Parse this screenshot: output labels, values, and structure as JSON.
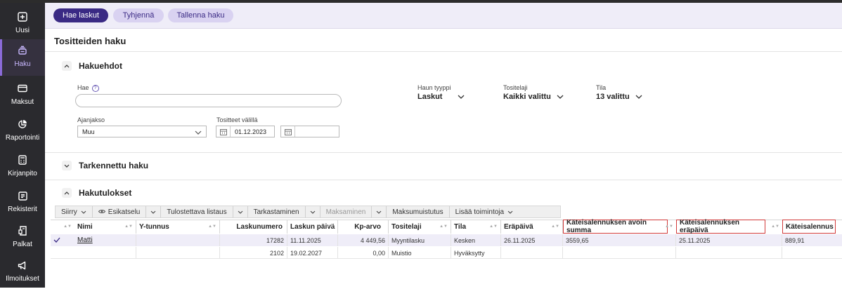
{
  "sidebar": {
    "items": [
      {
        "label": "Uusi",
        "icon": "plus-square-icon"
      },
      {
        "label": "Haku",
        "icon": "search-stack-icon",
        "active": true
      },
      {
        "label": "Maksut",
        "icon": "card-icon"
      },
      {
        "label": "Raportointi",
        "icon": "pie-chart-icon"
      },
      {
        "label": "Kirjanpito",
        "icon": "calculator-icon"
      },
      {
        "label": "Rekisterit",
        "icon": "register-icon"
      },
      {
        "label": "Palkat",
        "icon": "payslip-icon"
      },
      {
        "label": "Ilmoitukset",
        "icon": "megaphone-icon"
      }
    ]
  },
  "toolbar": {
    "search_label": "Hae laskut",
    "clear_label": "Tyhjennä",
    "save_label": "Tallenna haku"
  },
  "page": {
    "title": "Tositteiden haku"
  },
  "criteria": {
    "title": "Hakuehdot",
    "search_label": "Hae",
    "search_value": "",
    "period_label": "Ajanjakso",
    "period_value": "Muu",
    "docs_between_label": "Tositteet välillä",
    "date_from": "01.12.2023",
    "date_to": "",
    "search_type_label": "Haun tyyppi",
    "search_type_value": "Laskut",
    "doc_type_label": "Tositelaji",
    "doc_type_value": "Kaikki valittu",
    "status_label": "Tila",
    "status_value": "13 valittu"
  },
  "advanced": {
    "title": "Tarkennettu haku"
  },
  "results": {
    "title": "Hakutulokset",
    "actions": [
      {
        "label": "Siirry",
        "dropdown": true,
        "disabled": false
      },
      {
        "label": "Esikatselu",
        "icon": "eye-icon",
        "dropdown": false,
        "disabled": false
      },
      {
        "label": "",
        "dropdown": true,
        "disabled": false
      },
      {
        "label": "Tulostettava listaus",
        "dropdown": false,
        "disabled": false
      },
      {
        "label": "",
        "dropdown": true,
        "disabled": false
      },
      {
        "label": "Tarkastaminen",
        "dropdown": false,
        "disabled": false
      },
      {
        "label": "",
        "dropdown": true,
        "disabled": false
      },
      {
        "label": "Maksaminen",
        "dropdown": false,
        "disabled": true
      },
      {
        "label": "",
        "dropdown": true,
        "disabled": false
      },
      {
        "label": "Maksumuistutus",
        "dropdown": false,
        "disabled": false
      },
      {
        "label": "Lisää toimintoja",
        "dropdown": true,
        "disabled": false
      }
    ],
    "columns": [
      "Nimi",
      "Y-tunnus",
      "Laskunumero",
      "Laskun päivä",
      "Kp-arvo",
      "Tositelaji",
      "Tila",
      "Eräpäivä",
      "Käteisalennuksen avoin summa",
      "Käteisalennuksen eräpäivä",
      "Käteisalennus"
    ],
    "rows": [
      {
        "selected": true,
        "name": "Matti",
        "ytunnus": "",
        "number": "17282",
        "date": "11.11.2025",
        "amount": "4 449,56",
        "type": "Myyntilasku",
        "status": "Kesken",
        "due": "26.11.2025",
        "cd_open": "3559,65",
        "cd_due": "25.11.2025",
        "cd": "889,91"
      },
      {
        "selected": false,
        "name": "",
        "ytunnus": "",
        "number": "2102",
        "date": "19.02.2027",
        "amount": "0,00",
        "type": "Muistio",
        "status": "Hyväksytty",
        "due": "",
        "cd_open": "",
        "cd_due": "",
        "cd": ""
      }
    ]
  },
  "colors": {
    "accent": "#3a2a84",
    "sidebar": "#2a2a2e",
    "highlight": "#d23a3a",
    "selected_row": "#efedf8"
  }
}
